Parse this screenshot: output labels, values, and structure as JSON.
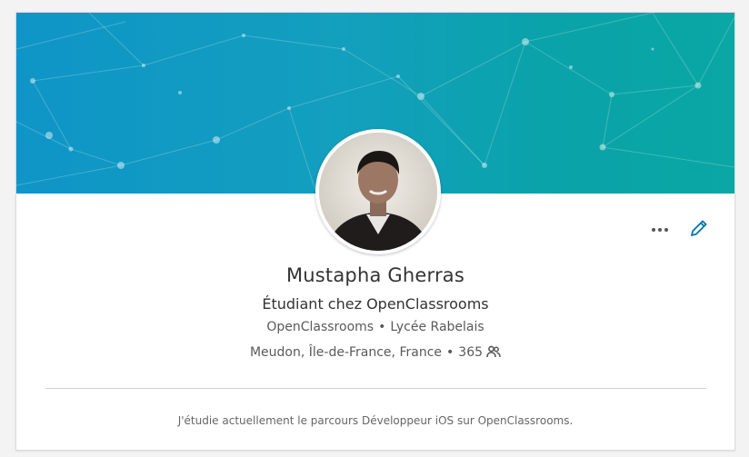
{
  "profile": {
    "name": "Mustapha Gherras",
    "headline": "Étudiant chez OpenClassrooms",
    "company": "OpenClassrooms",
    "school": "Lycée Rabelais",
    "location": "Meudon, Île-de-France, France",
    "connections": "365",
    "summary": "J'étudie actuellement le parcours Développeur iOS sur OpenClassrooms."
  },
  "icons": {
    "more": "more-horizontal-icon",
    "edit": "pencil-icon",
    "connections": "people-icon"
  },
  "colors": {
    "banner_start": "#0f95c7",
    "banner_end": "#0aa7a4",
    "edit_icon": "#0073b1"
  }
}
